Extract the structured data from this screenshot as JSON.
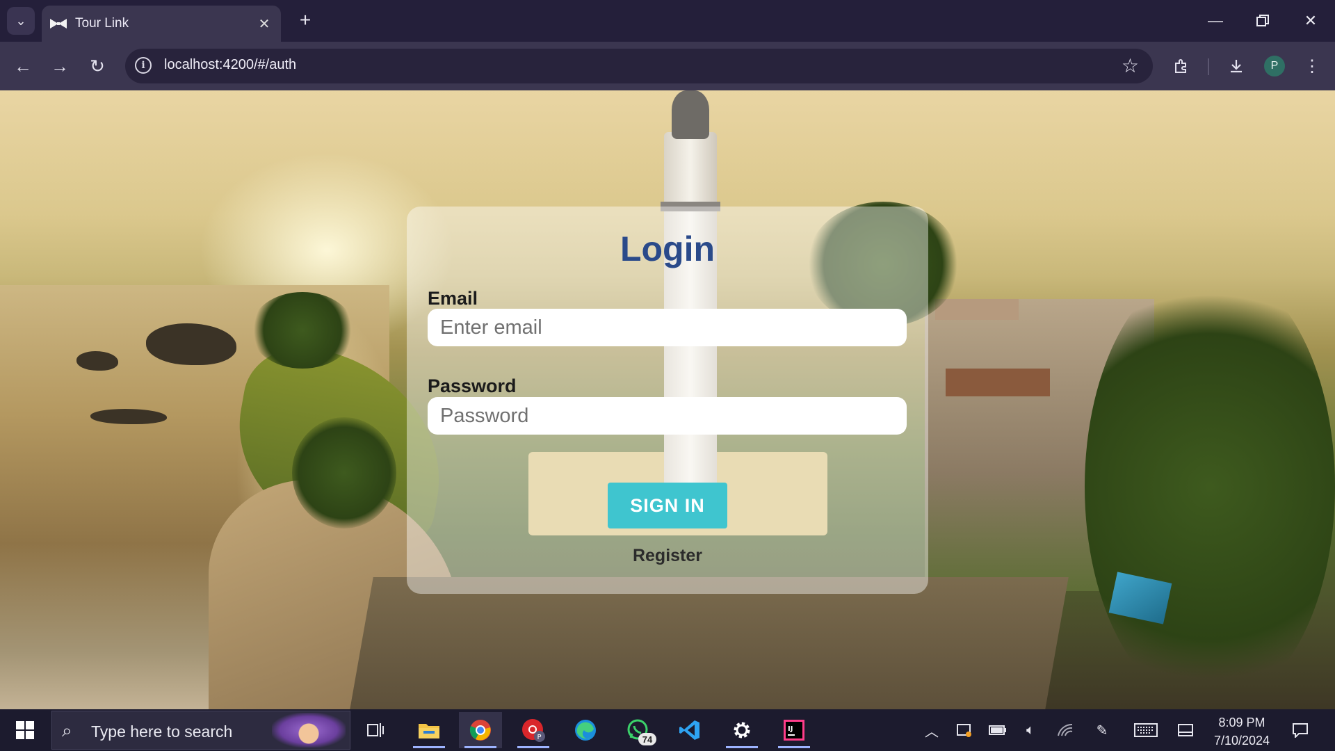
{
  "browser": {
    "tab": {
      "title": "Tour Link"
    },
    "address_bar": {
      "url": "localhost:4200/#/auth"
    },
    "profile_initial": "P"
  },
  "login": {
    "title": "Login",
    "email": {
      "label": "Email",
      "placeholder": "Enter email",
      "value": ""
    },
    "password": {
      "label": "Password",
      "placeholder": "Password",
      "value": ""
    },
    "submit_label": "SIGN IN",
    "register_label": "Register"
  },
  "taskbar": {
    "search_placeholder": "Type here to search",
    "apps": [
      {
        "name": "file-explorer-icon"
      },
      {
        "name": "chrome-icon"
      },
      {
        "name": "chrome-profile-icon"
      },
      {
        "name": "edge-icon"
      },
      {
        "name": "whatsapp-icon",
        "badge": "74"
      },
      {
        "name": "vscode-icon"
      },
      {
        "name": "settings-gear-icon"
      },
      {
        "name": "intellij-icon"
      }
    ],
    "clock": {
      "time": "8:09 PM",
      "date": "7/10/2024"
    }
  },
  "colors": {
    "title_blue": "#2a4a8a",
    "button_teal": "#3fc5cf",
    "browser_frame": "#241f3a",
    "toolbar": "#3b3650",
    "taskbar": "#1c1b2e"
  }
}
